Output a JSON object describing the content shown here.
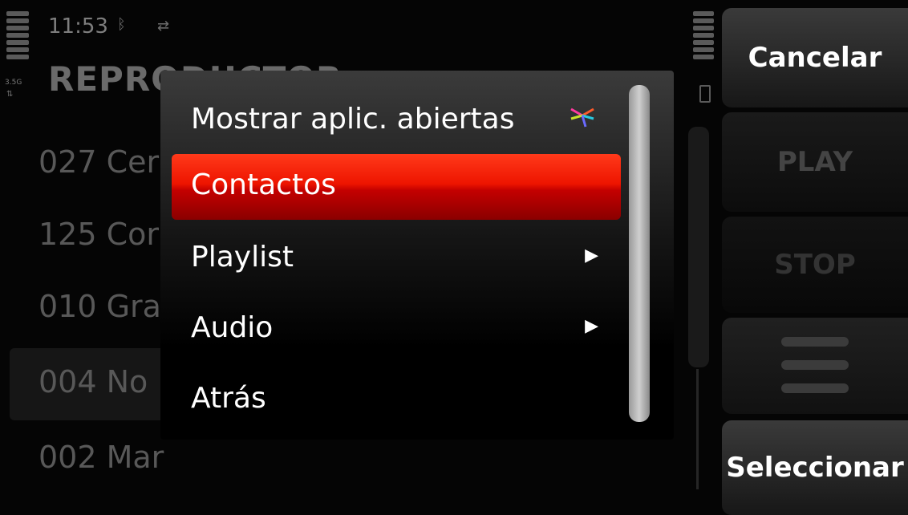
{
  "status": {
    "time": "11:53",
    "network": "3.5G",
    "app_title": "REPRODUCTOR"
  },
  "background_list": [
    {
      "label": "027 Cer"
    },
    {
      "label": "125 Cor"
    },
    {
      "label": "010 Gra"
    },
    {
      "label": "004 No"
    },
    {
      "label": "002 Mar"
    }
  ],
  "softkeys": {
    "cancel": "Cancelar",
    "play": "PLAY",
    "stop": "STOP",
    "select": "Seleccionar"
  },
  "menu": {
    "items": [
      {
        "label": "Mostrar aplic. abiertas"
      },
      {
        "label": "Contactos"
      },
      {
        "label": "Playlist"
      },
      {
        "label": "Audio"
      },
      {
        "label": "Atrás"
      }
    ]
  },
  "colors": {
    "highlight": "#ee1500",
    "background": "#050505"
  },
  "icons": {
    "app_switcher": "app-switcher-icon",
    "submenu": "chevron-right-icon"
  }
}
